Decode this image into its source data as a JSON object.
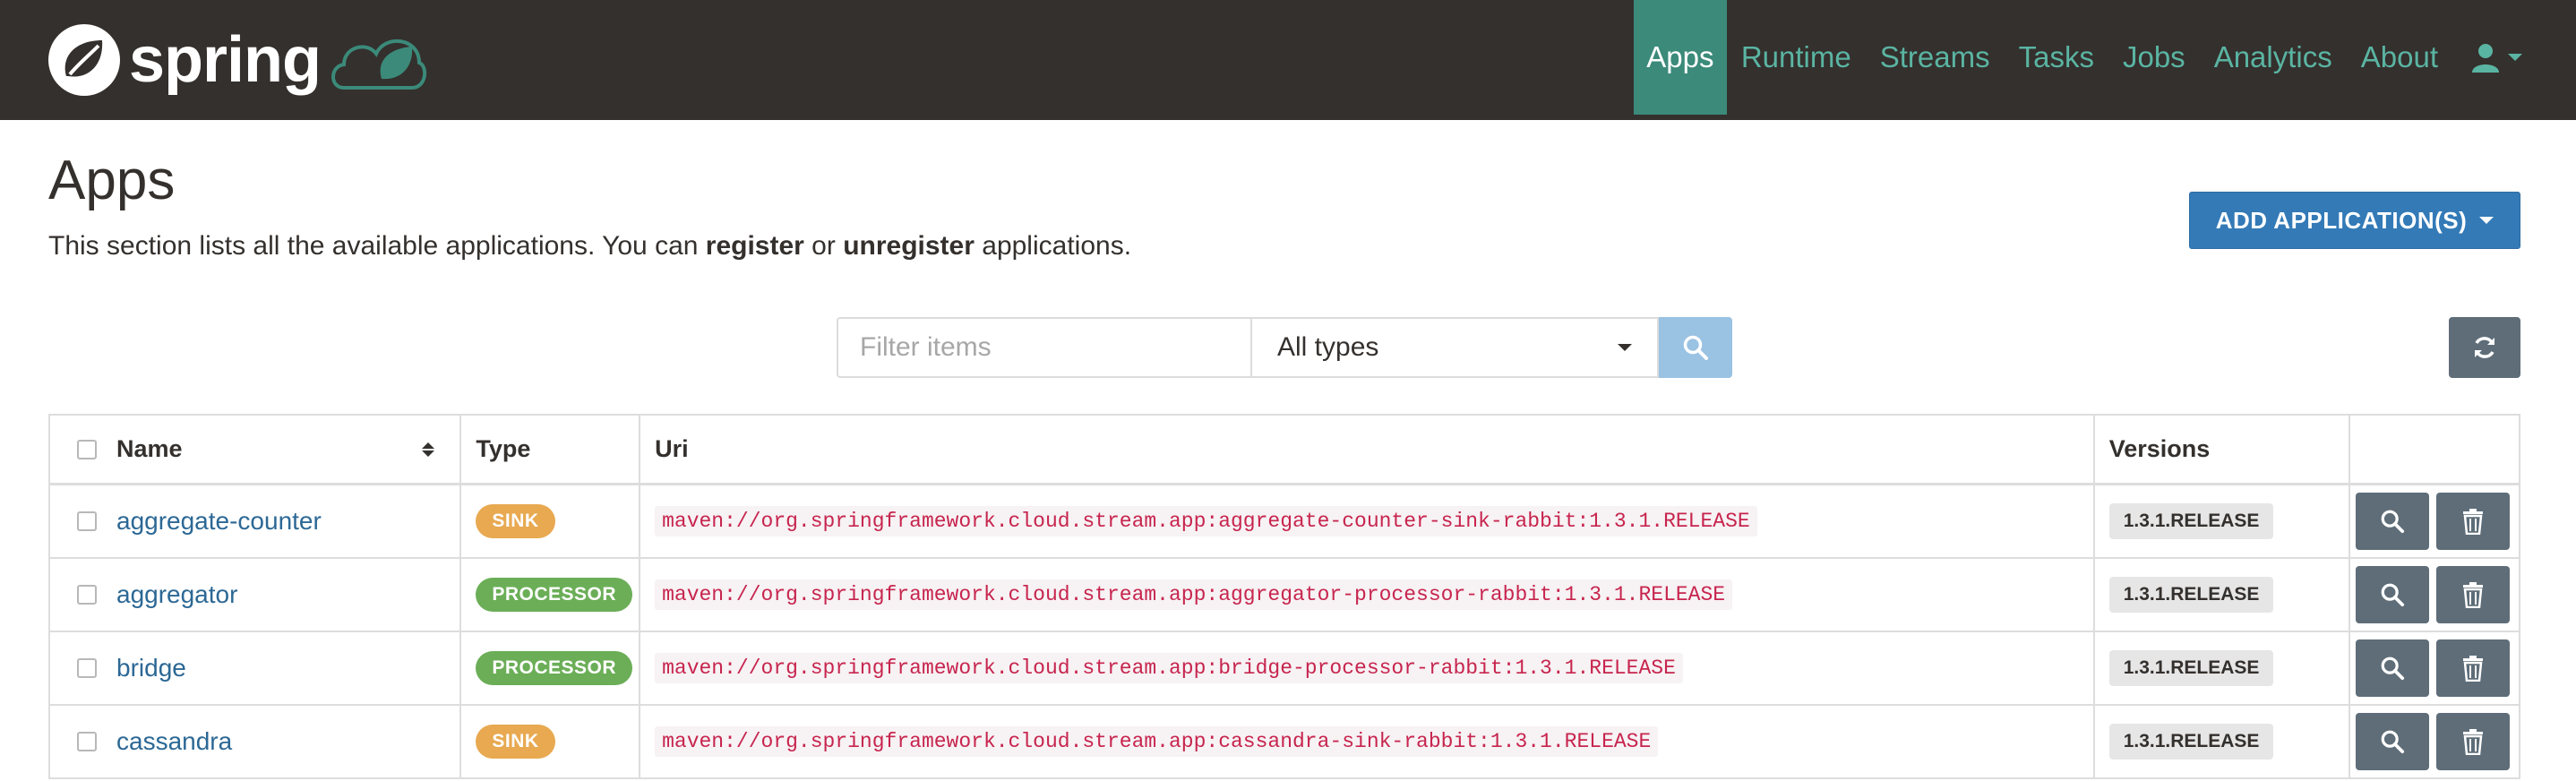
{
  "navbar": {
    "brand": "spring",
    "items": [
      {
        "label": "Apps",
        "active": true
      },
      {
        "label": "Runtime",
        "active": false
      },
      {
        "label": "Streams",
        "active": false
      },
      {
        "label": "Tasks",
        "active": false
      },
      {
        "label": "Jobs",
        "active": false
      },
      {
        "label": "Analytics",
        "active": false
      },
      {
        "label": "About",
        "active": false
      }
    ],
    "user_icon": "user-icon"
  },
  "header": {
    "title": "Apps",
    "desc_prefix": "This section lists all the available applications. You can ",
    "desc_register": "register",
    "desc_or": " or ",
    "desc_unregister": "unregister",
    "desc_suffix": " applications.",
    "add_button": "ADD APPLICATION(S)"
  },
  "filter": {
    "placeholder": "Filter items",
    "type_selected": "All types"
  },
  "table": {
    "columns": {
      "name": "Name",
      "type": "Type",
      "uri": "Uri",
      "versions": "Versions"
    },
    "rows": [
      {
        "name": "aggregate-counter",
        "type": "SINK",
        "uri": "maven://org.springframework.cloud.stream.app:aggregate-counter-sink-rabbit:1.3.1.RELEASE",
        "version": "1.3.1.RELEASE"
      },
      {
        "name": "aggregator",
        "type": "PROCESSOR",
        "uri": "maven://org.springframework.cloud.stream.app:aggregator-processor-rabbit:1.3.1.RELEASE",
        "version": "1.3.1.RELEASE"
      },
      {
        "name": "bridge",
        "type": "PROCESSOR",
        "uri": "maven://org.springframework.cloud.stream.app:bridge-processor-rabbit:1.3.1.RELEASE",
        "version": "1.3.1.RELEASE"
      },
      {
        "name": "cassandra",
        "type": "SINK",
        "uri": "maven://org.springframework.cloud.stream.app:cassandra-sink-rabbit:1.3.1.RELEASE",
        "version": "1.3.1.RELEASE"
      }
    ]
  },
  "colors": {
    "navbar_bg": "#34302d",
    "nav_active_bg": "#3b8a7a",
    "nav_link": "#5ab4a2",
    "primary_button": "#337ab7",
    "sink_badge": "#e8a951",
    "processor_badge": "#6bae57",
    "action_button": "#5e6d78"
  }
}
